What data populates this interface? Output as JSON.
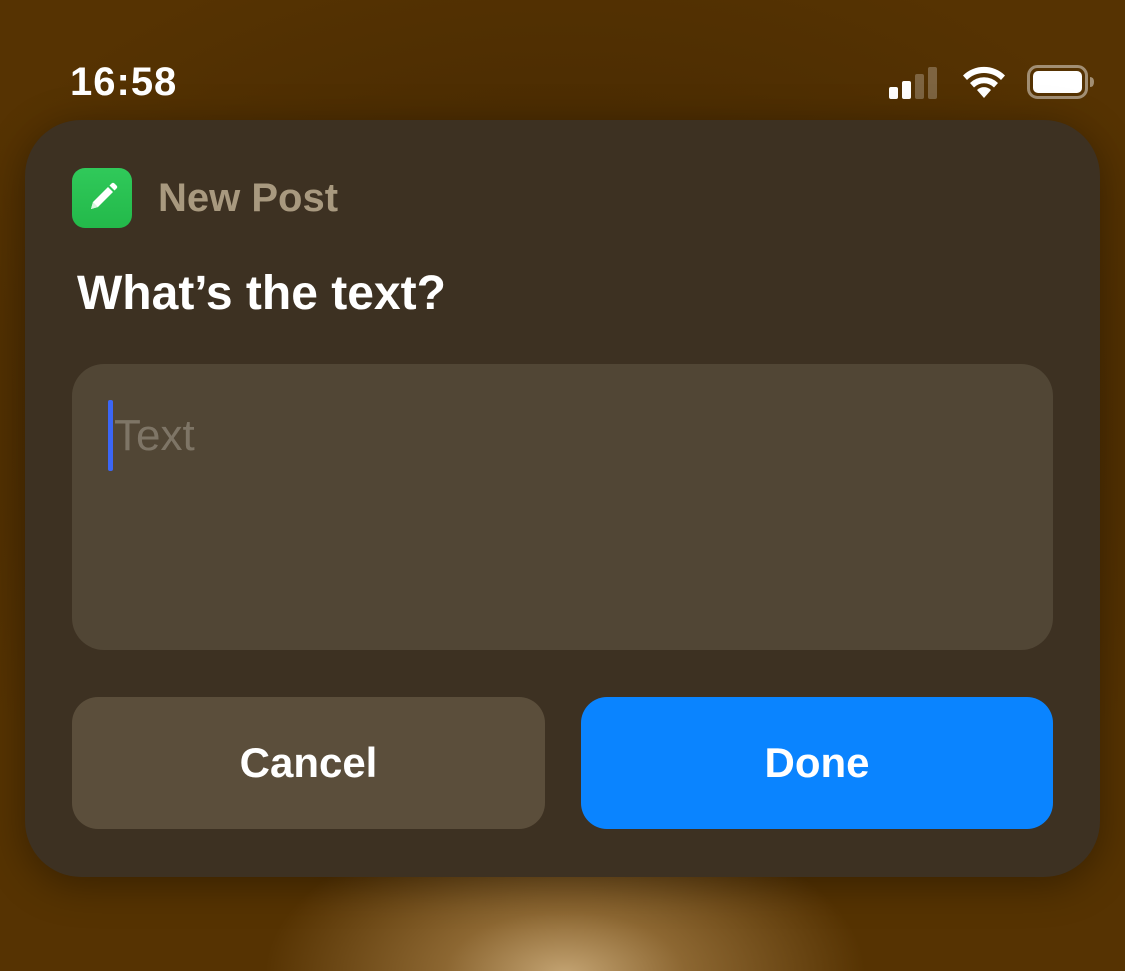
{
  "status_bar": {
    "time": "16:58",
    "signal_bars_active": 2,
    "signal_bars_total": 4,
    "wifi_icon": "wifi-icon",
    "battery_icon": "battery-icon"
  },
  "dialog": {
    "app": {
      "icon": "pencil-icon",
      "icon_color": "#28C050",
      "name": "New Post"
    },
    "prompt": "What’s the text?",
    "text_field": {
      "value": "",
      "placeholder": "Text"
    },
    "buttons": {
      "cancel_label": "Cancel",
      "done_label": "Done"
    },
    "colors": {
      "accent": "#0A84FF",
      "cursor": "#3B66F5"
    }
  }
}
